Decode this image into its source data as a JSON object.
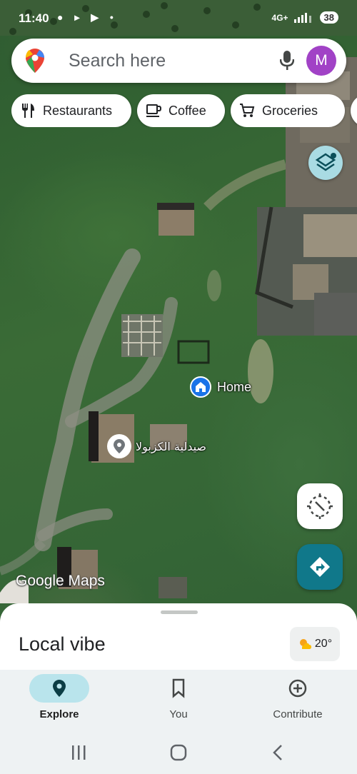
{
  "status_bar": {
    "time": "11:40",
    "icons_left": "● ▸ ▶ •",
    "network": "4G+",
    "battery": "38"
  },
  "search": {
    "placeholder": "Search here",
    "avatar_letter": "M"
  },
  "chips": [
    {
      "label": "Restaurants",
      "icon": "fork-knife-icon"
    },
    {
      "label": "Coffee",
      "icon": "coffee-cup-icon"
    },
    {
      "label": "Groceries",
      "icon": "cart-icon"
    }
  ],
  "map": {
    "home_label": "Home",
    "pharmacy_label": "صيدلية الكزبولا",
    "logo_text": "Google Maps"
  },
  "sheet": {
    "title": "Local vibe",
    "weather_temp": "20°"
  },
  "bottom_nav": [
    {
      "label": "Explore",
      "icon": "location-pin-icon",
      "active": true
    },
    {
      "label": "You",
      "icon": "bookmark-icon",
      "active": false
    },
    {
      "label": "Contribute",
      "icon": "plus-circle-icon",
      "active": false
    }
  ],
  "colors": {
    "accent": "#10788a",
    "avatar": "#a142c6",
    "active_pill": "#b9e4ec"
  }
}
